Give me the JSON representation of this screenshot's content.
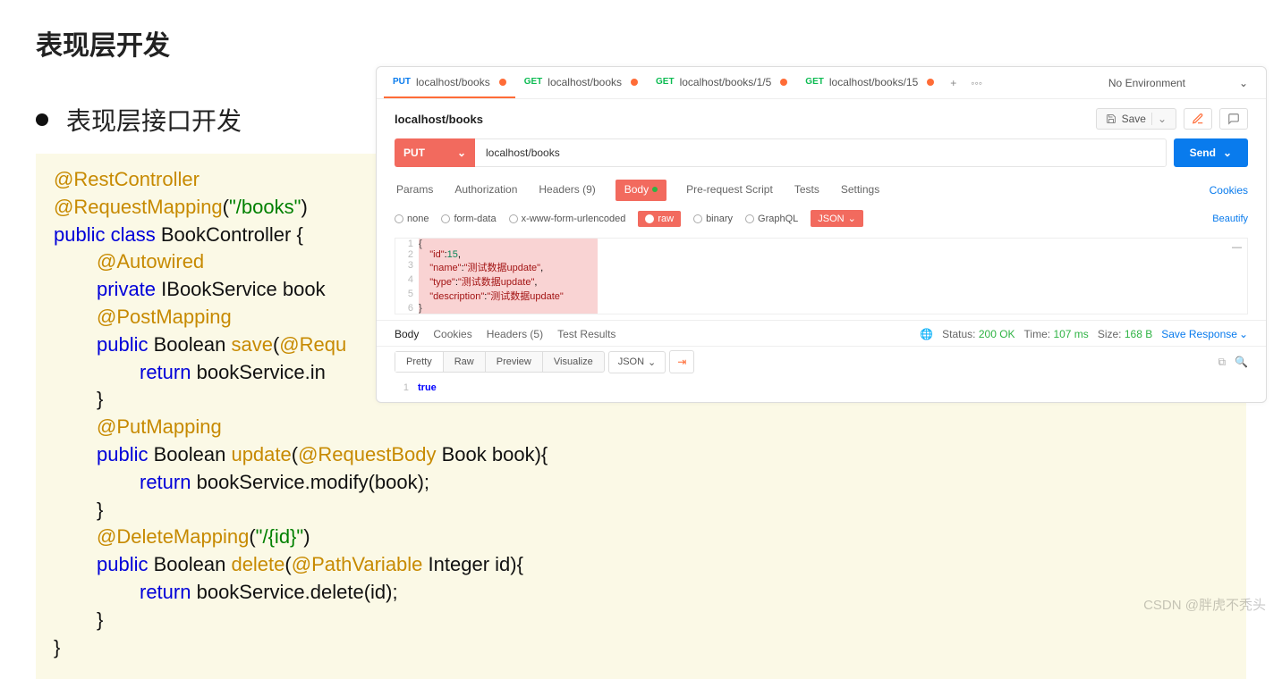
{
  "page": {
    "title": "表现层开发",
    "bullet": "表现层接口开发"
  },
  "code": [
    {
      "cls": "",
      "html": "<span class='anno'>@RestController</span>"
    },
    {
      "cls": "",
      "html": "<span class='anno'>@RequestMapping</span>(<span class='str'>\"/books\"</span>)"
    },
    {
      "cls": "",
      "html": "<span class='kw'>public</span> <span class='kw'>class</span> BookController {"
    },
    {
      "cls": "ind1",
      "html": "<span class='anno'>@Autowired</span>"
    },
    {
      "cls": "ind1",
      "html": "<span class='kw'>private</span> IBookService book"
    },
    {
      "cls": "ind1",
      "html": "<span class='anno'>@PostMapping</span>"
    },
    {
      "cls": "ind1",
      "html": "<span class='kw'>public</span> Boolean <span class='meth'>save</span>(<span class='anno'>@Requ</span>"
    },
    {
      "cls": "ind2",
      "html": "<span class='kw'>return</span> bookService.in"
    },
    {
      "cls": "ind1",
      "html": "}"
    },
    {
      "cls": "ind1",
      "html": "<span class='anno'>@PutMapping</span>"
    },
    {
      "cls": "ind1",
      "html": "<span class='kw'>public</span> Boolean <span class='meth'>update</span>(<span class='anno'>@RequestBody</span> Book book){"
    },
    {
      "cls": "ind2",
      "html": "<span class='kw'>return</span> bookService.modify(book);"
    },
    {
      "cls": "ind1",
      "html": "}"
    },
    {
      "cls": "ind1",
      "html": "<span class='anno'>@DeleteMapping</span>(<span class='str'>\"/{id}\"</span>)"
    },
    {
      "cls": "ind1",
      "html": "<span class='kw'>public</span> Boolean <span class='meth'>delete</span>(<span class='anno'>@PathVariable</span> Integer id){"
    },
    {
      "cls": "ind2",
      "html": "<span class='kw'>return</span> bookService.delete(id);"
    },
    {
      "cls": "ind1",
      "html": "}"
    },
    {
      "cls": "",
      "html": "}"
    }
  ],
  "postman": {
    "tabs": [
      {
        "method": "PUT",
        "url": "localhost/books",
        "active": true,
        "dirty": true
      },
      {
        "method": "GET",
        "url": "localhost/books",
        "active": false,
        "dirty": true
      },
      {
        "method": "GET",
        "url": "localhost/books/1/5",
        "active": false,
        "dirty": true
      },
      {
        "method": "GET",
        "url": "localhost/books/15",
        "active": false,
        "dirty": true
      }
    ],
    "env": "No Environment",
    "request_title": "localhost/books",
    "save_label": "Save",
    "method": "PUT",
    "url": "localhost/books",
    "send_label": "Send",
    "req_tabs": {
      "params": "Params",
      "auth": "Authorization",
      "headers": "Headers (9)",
      "body": "Body",
      "prereq": "Pre-request Script",
      "tests": "Tests",
      "settings": "Settings",
      "cookies": "Cookies"
    },
    "body_types": {
      "none": "none",
      "form": "form-data",
      "xwww": "x-www-form-urlencoded",
      "raw": "raw",
      "binary": "binary",
      "graphql": "GraphQL",
      "json": "JSON",
      "beautify": "Beautify"
    },
    "body_raw_lines": [
      {
        "n": 1,
        "html": "<span class='jpunc'>{</span>",
        "hl": true
      },
      {
        "n": 2,
        "html": "    <span class='jkey'>\"id\"</span>:<span class='jnum'>15</span>,",
        "hl": true
      },
      {
        "n": 3,
        "html": "    <span class='jkey'>\"name\"</span>:<span class='jval'>\"测试数据update\"</span>,",
        "hl": true
      },
      {
        "n": 4,
        "html": "    <span class='jkey'>\"type\"</span>:<span class='jval'>\"测试数据update\"</span>,",
        "hl": true
      },
      {
        "n": 5,
        "html": "    <span class='jkey'>\"description\"</span>:<span class='jval'>\"测试数据update\"</span>",
        "hl": true
      },
      {
        "n": 6,
        "html": "<span class='jpunc'>}</span>",
        "hl": true
      }
    ],
    "response": {
      "tabs": {
        "body": "Body",
        "cookies": "Cookies",
        "headers": "Headers (5)",
        "tests": "Test Results"
      },
      "status_label": "Status:",
      "status": "200 OK",
      "time_label": "Time:",
      "time": "107 ms",
      "size_label": "Size:",
      "size": "168 B",
      "save": "Save Response",
      "formats": {
        "pretty": "Pretty",
        "raw": "Raw",
        "preview": "Preview",
        "visualize": "Visualize",
        "json": "JSON"
      },
      "body_lines": [
        {
          "n": 1,
          "html": "<span class='kw'>true</span>"
        }
      ]
    }
  },
  "watermark": "CSDN @胖虎不秃头"
}
